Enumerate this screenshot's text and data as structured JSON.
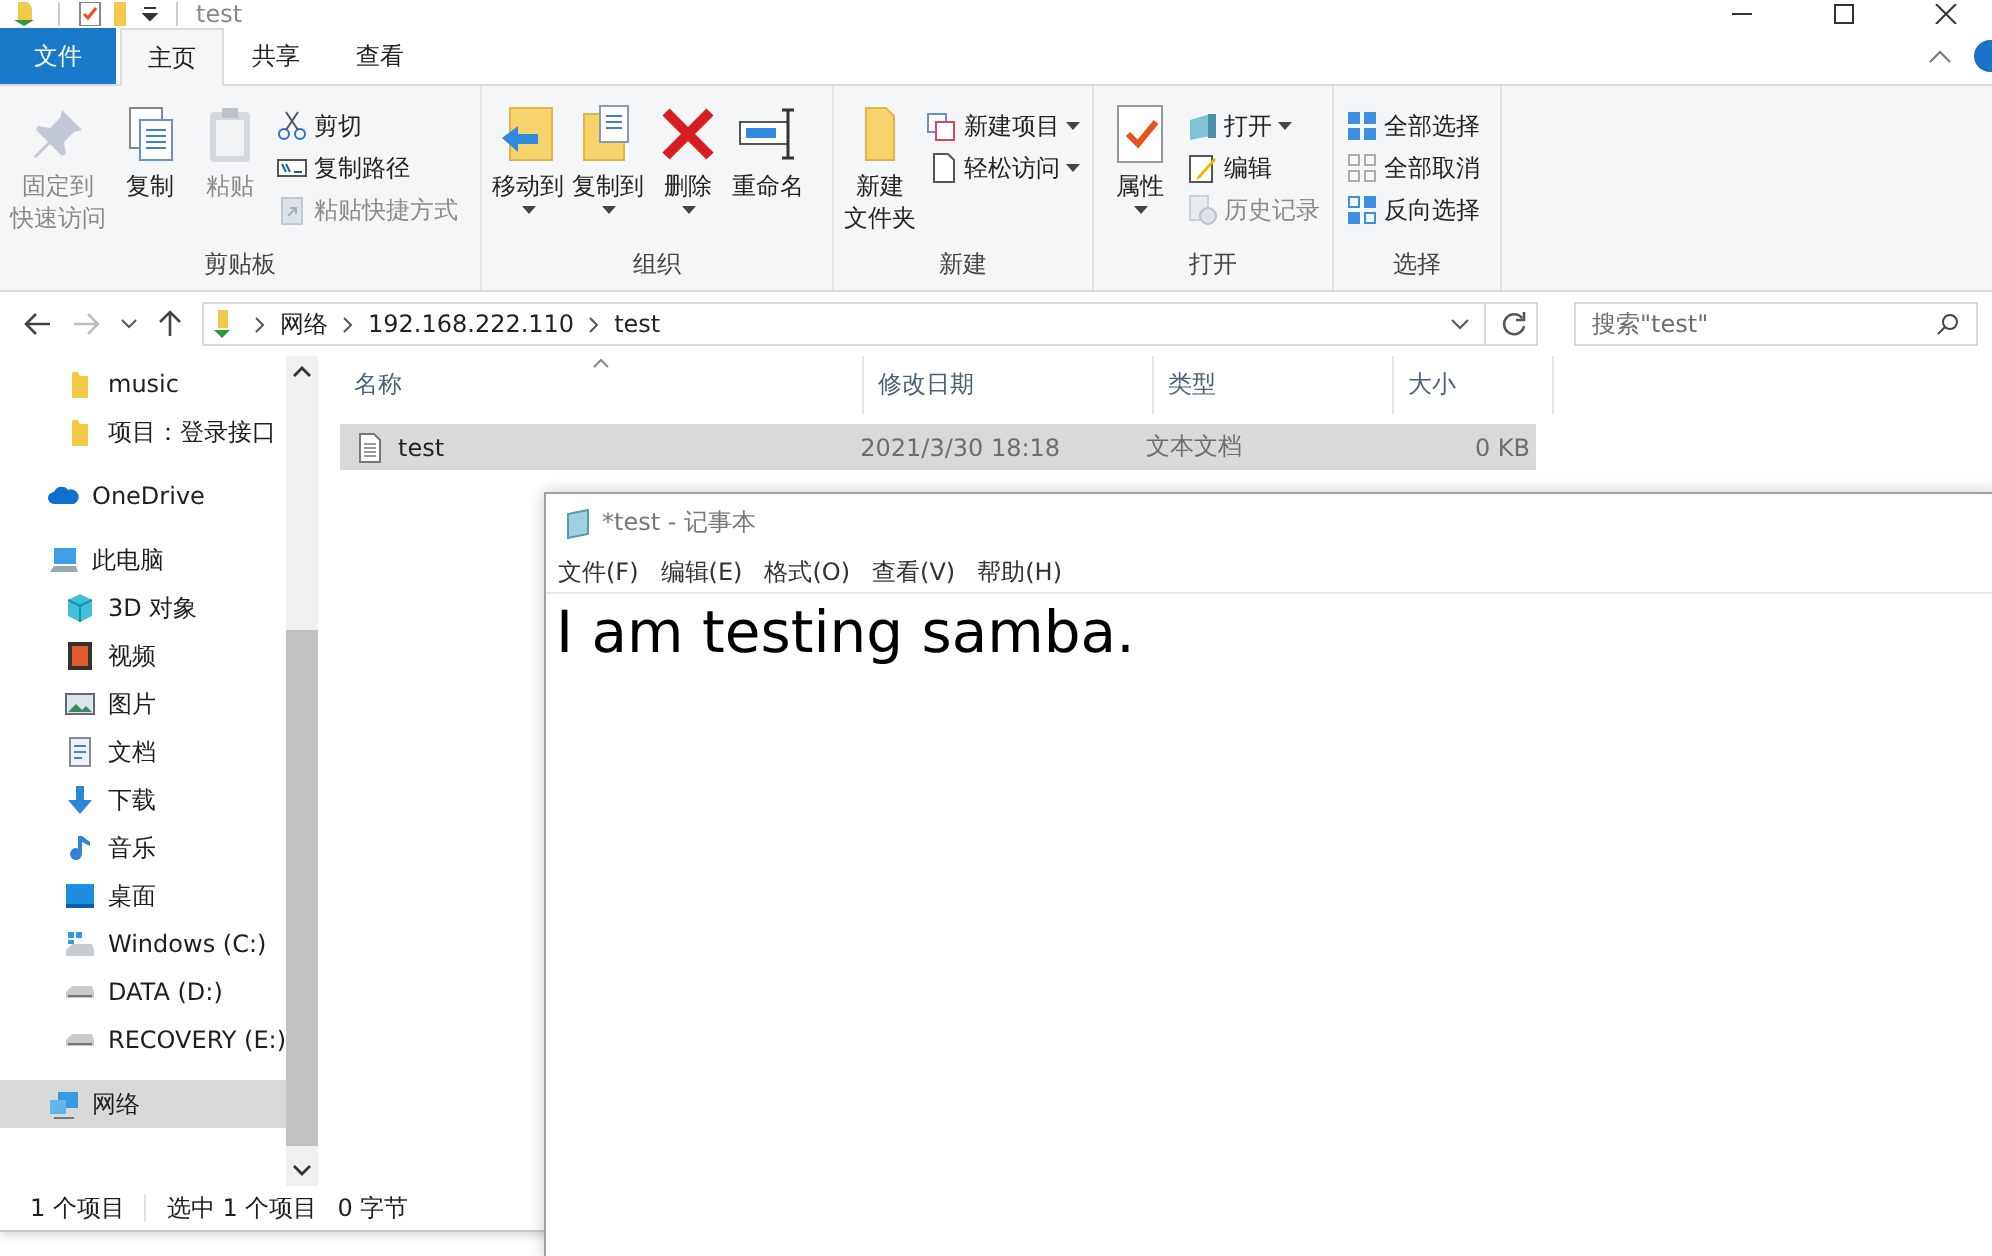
{
  "window": {
    "title": "test"
  },
  "ribbon_tabs": [
    {
      "label": "文件",
      "kind": "file",
      "selected": false
    },
    {
      "label": "主页",
      "kind": "tab",
      "selected": true
    },
    {
      "label": "共享",
      "kind": "tab",
      "selected": false
    },
    {
      "label": "查看",
      "kind": "tab",
      "selected": false
    }
  ],
  "ribbon_groups": [
    {
      "label": "剪贴板",
      "large": [
        {
          "lines": [
            "固定到",
            "快速访问"
          ],
          "disabled": true,
          "dropdown": false
        },
        {
          "lines": [
            "复制"
          ],
          "disabled": false,
          "dropdown": false
        },
        {
          "lines": [
            "粘贴"
          ],
          "disabled": true,
          "dropdown": false
        }
      ],
      "small": [
        {
          "label": "剪切",
          "disabled": false,
          "dropdown": false
        },
        {
          "label": "复制路径",
          "disabled": false,
          "dropdown": false
        },
        {
          "label": "粘贴快捷方式",
          "disabled": true,
          "dropdown": false
        }
      ]
    },
    {
      "label": "组织",
      "large": [
        {
          "lines": [
            "移动到"
          ],
          "disabled": false,
          "dropdown": true
        },
        {
          "lines": [
            "复制到"
          ],
          "disabled": false,
          "dropdown": true
        },
        {
          "lines": [
            "删除"
          ],
          "disabled": false,
          "dropdown": true
        },
        {
          "lines": [
            "重命名"
          ],
          "disabled": false,
          "dropdown": false
        }
      ]
    },
    {
      "label": "新建",
      "large": [
        {
          "lines": [
            "新建",
            "文件夹"
          ],
          "disabled": false,
          "dropdown": false
        }
      ],
      "small": [
        {
          "label": "新建项目",
          "disabled": false,
          "dropdown": true
        },
        {
          "label": "轻松访问",
          "disabled": false,
          "dropdown": true
        }
      ]
    },
    {
      "label": "打开",
      "large": [
        {
          "lines": [
            "属性"
          ],
          "disabled": false,
          "dropdown": true
        }
      ],
      "small": [
        {
          "label": "打开",
          "disabled": false,
          "dropdown": true
        },
        {
          "label": "编辑",
          "disabled": false,
          "dropdown": false
        },
        {
          "label": "历史记录",
          "disabled": true,
          "dropdown": false
        }
      ]
    },
    {
      "label": "选择",
      "small": [
        {
          "label": "全部选择",
          "disabled": false,
          "dropdown": false
        },
        {
          "label": "全部取消",
          "disabled": false,
          "dropdown": false
        },
        {
          "label": "反向选择",
          "disabled": false,
          "dropdown": false
        }
      ]
    }
  ],
  "address": {
    "breadcrumbs": [
      "网络",
      "192.168.222.110",
      "test"
    ],
    "search_placeholder": "搜索\"test\""
  },
  "sidebar": {
    "quick_access_children": [
      {
        "label": "music",
        "selected": false
      },
      {
        "label": "项目：登录接口",
        "selected": false
      }
    ],
    "items": [
      {
        "label": "OneDrive",
        "selected": false
      },
      {
        "label": "此电脑",
        "selected": false,
        "children": [
          {
            "label": "3D 对象",
            "selected": false
          },
          {
            "label": "视频",
            "selected": false
          },
          {
            "label": "图片",
            "selected": false
          },
          {
            "label": "文档",
            "selected": false
          },
          {
            "label": "下载",
            "selected": false
          },
          {
            "label": "音乐",
            "selected": false
          },
          {
            "label": "桌面",
            "selected": false
          },
          {
            "label": "Windows (C:)",
            "selected": false
          },
          {
            "label": "DATA (D:)",
            "selected": false
          },
          {
            "label": "RECOVERY (E:)",
            "selected": false
          }
        ]
      },
      {
        "label": "网络",
        "selected": true
      }
    ]
  },
  "file_list": {
    "columns": [
      {
        "label": "名称",
        "sorted": true
      },
      {
        "label": "修改日期",
        "sorted": false
      },
      {
        "label": "类型",
        "sorted": false
      },
      {
        "label": "大小",
        "sorted": false
      }
    ],
    "rows": [
      {
        "cells": [
          "test",
          "2021/3/30 18:18",
          "文本文档",
          "0 KB"
        ],
        "selected": true
      }
    ]
  },
  "status_bar": {
    "item_count": "1 个项目",
    "selection": "选中 1 个项目",
    "size": "0 字节"
  },
  "notepad": {
    "title": "*test - 记事本",
    "menu": [
      "文件(F)",
      "编辑(E)",
      "格式(O)",
      "查看(V)",
      "帮助(H)"
    ],
    "text": "I am testing samba."
  }
}
